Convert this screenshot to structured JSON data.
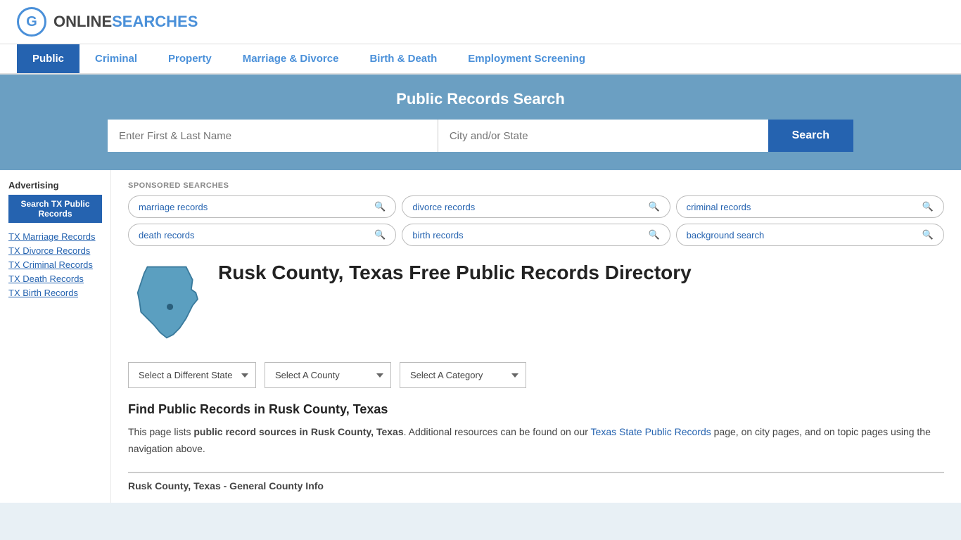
{
  "header": {
    "logo_letter": "G",
    "logo_text_online": "ONLINE",
    "logo_text_searches": "SEARCHES"
  },
  "nav": {
    "items": [
      {
        "label": "Public",
        "active": true
      },
      {
        "label": "Criminal",
        "active": false
      },
      {
        "label": "Property",
        "active": false
      },
      {
        "label": "Marriage & Divorce",
        "active": false
      },
      {
        "label": "Birth & Death",
        "active": false
      },
      {
        "label": "Employment Screening",
        "active": false
      }
    ]
  },
  "search_banner": {
    "title": "Public Records Search",
    "name_placeholder": "Enter First & Last Name",
    "location_placeholder": "City and/or State",
    "button_label": "Search"
  },
  "sponsored": {
    "label": "SPONSORED SEARCHES",
    "tags": [
      {
        "label": "marriage records"
      },
      {
        "label": "divorce records"
      },
      {
        "label": "criminal records"
      },
      {
        "label": "death records"
      },
      {
        "label": "birth records"
      },
      {
        "label": "background search"
      }
    ]
  },
  "county": {
    "title": "Rusk County, Texas Free Public Records Directory"
  },
  "dropdowns": {
    "state_label": "Select a Different State",
    "county_label": "Select A County",
    "category_label": "Select A Category"
  },
  "find_section": {
    "heading": "Find Public Records in Rusk County, Texas",
    "body_pre": "This page lists ",
    "body_bold": "public record sources in Rusk County, Texas",
    "body_mid": ". Additional resources can be found on our ",
    "link_text": "Texas State Public Records",
    "body_post": " page, on city pages, and on topic pages using the navigation above."
  },
  "info_bar": {
    "title": "Rusk County, Texas - General County Info"
  },
  "sidebar": {
    "ad_label": "Advertising",
    "ad_button": "Search TX Public Records",
    "links": [
      {
        "label": "TX Marriage Records"
      },
      {
        "label": "TX Divorce Records"
      },
      {
        "label": "TX Criminal Records"
      },
      {
        "label": "TX Death Records"
      },
      {
        "label": "TX Birth Records"
      }
    ]
  }
}
